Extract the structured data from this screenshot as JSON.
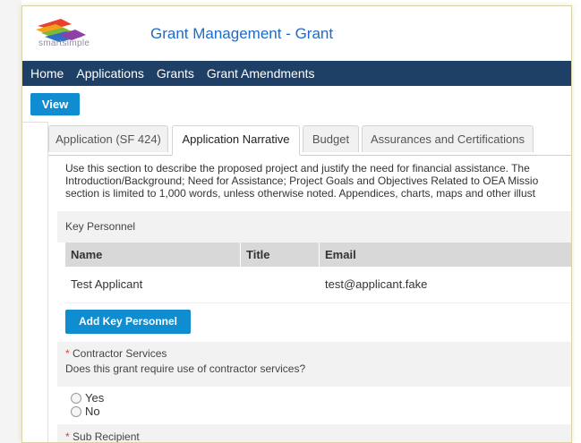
{
  "header": {
    "logo_text": "smartsimple",
    "title": "Grant Management - Grant"
  },
  "nav": {
    "items": [
      "Home",
      "Applications",
      "Grants",
      "Grant Amendments"
    ]
  },
  "toolbar": {
    "view_label": "View"
  },
  "tabs": [
    {
      "label": "Application (SF 424)",
      "active": false
    },
    {
      "label": "Application Narrative",
      "active": true
    },
    {
      "label": "Budget",
      "active": false
    },
    {
      "label": "Assurances and Certifications",
      "active": false
    }
  ],
  "intro": {
    "line1": "Use this section to describe the proposed project and justify the need for financial assistance. The",
    "line2": "Introduction/Background; Need for Assistance; Project Goals and Objectives Related to OEA Missio",
    "line3": "section is limited to 1,000 words, unless otherwise noted. Appendices, charts, maps and other illust"
  },
  "key_personnel": {
    "section_label": "Key Personnel",
    "columns": [
      "Name",
      "Title",
      "Email"
    ],
    "rows": [
      {
        "name": "Test Applicant",
        "title": "",
        "email": "test@applicant.fake"
      }
    ],
    "add_button_label": "Add Key Personnel"
  },
  "contractor_services": {
    "required_mark": "*",
    "label": "Contractor Services",
    "question": "Does this grant require use of contractor services?",
    "options": [
      "Yes",
      "No"
    ]
  },
  "sub_recipient": {
    "required_mark": "*",
    "label": "Sub Recipient"
  },
  "colors": {
    "navbar": "#1e3f66",
    "accent_button": "#0f8dd0",
    "title_blue": "#1c6bc9",
    "required_red": "#e0413b"
  }
}
